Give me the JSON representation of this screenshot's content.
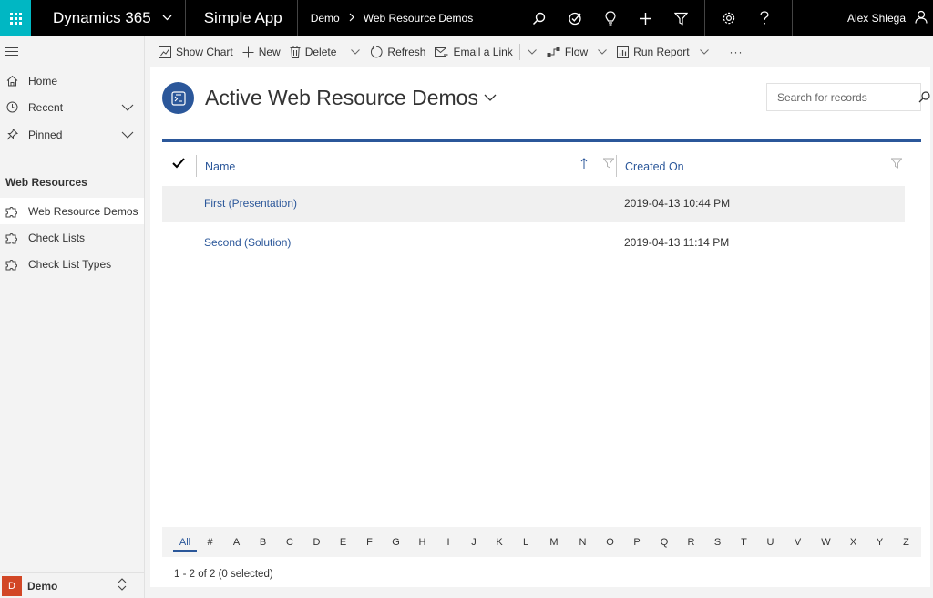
{
  "topbar": {
    "product": "Dynamics 365",
    "app_name": "Simple App",
    "breadcrumb": [
      "Demo",
      "Web Resource Demos"
    ],
    "user_name": "Alex Shlega",
    "icons": [
      "search-icon",
      "task-check-icon",
      "lightbulb-icon",
      "plus-icon",
      "filter-icon",
      "gear-icon",
      "help-icon",
      "user-icon"
    ]
  },
  "sidebar": {
    "items": [
      {
        "label": "Home",
        "icon": "home-icon"
      },
      {
        "label": "Recent",
        "icon": "clock-icon"
      },
      {
        "label": "Pinned",
        "icon": "pin-icon"
      }
    ],
    "group_title": "Web Resources",
    "group_items": [
      {
        "label": "Web Resource Demos",
        "icon": "puzzle-icon",
        "active": true
      },
      {
        "label": "Check Lists",
        "icon": "puzzle-icon"
      },
      {
        "label": "Check List Types",
        "icon": "puzzle-icon"
      }
    ],
    "area": {
      "badge": "D",
      "label": "Demo",
      "badge_color": "#d24726"
    }
  },
  "commandbar": {
    "show_chart": "Show Chart",
    "new": "New",
    "delete": "Delete",
    "refresh": "Refresh",
    "email_link": "Email a Link",
    "flow": "Flow",
    "run_report": "Run Report",
    "more": "···"
  },
  "view": {
    "title": "Active Web Resource Demos",
    "search_placeholder": "Search for records"
  },
  "grid": {
    "columns": [
      "Name",
      "Created On"
    ],
    "rows": [
      {
        "name": "First (Presentation)",
        "created_on": "2019-04-13 10:44 PM"
      },
      {
        "name": "Second (Solution)",
        "created_on": "2019-04-13 11:14 PM"
      }
    ],
    "alphabet": [
      "All",
      "#",
      "A",
      "B",
      "C",
      "D",
      "E",
      "F",
      "G",
      "H",
      "I",
      "J",
      "K",
      "L",
      "M",
      "N",
      "O",
      "P",
      "Q",
      "R",
      "S",
      "T",
      "U",
      "V",
      "W",
      "X",
      "Y",
      "Z"
    ],
    "active_letter": "All",
    "footer": "1 - 2 of 2 (0 selected)"
  },
  "colors": {
    "accent": "#2b579a",
    "waffle": "#00b7c3",
    "topbar": "#000000"
  }
}
